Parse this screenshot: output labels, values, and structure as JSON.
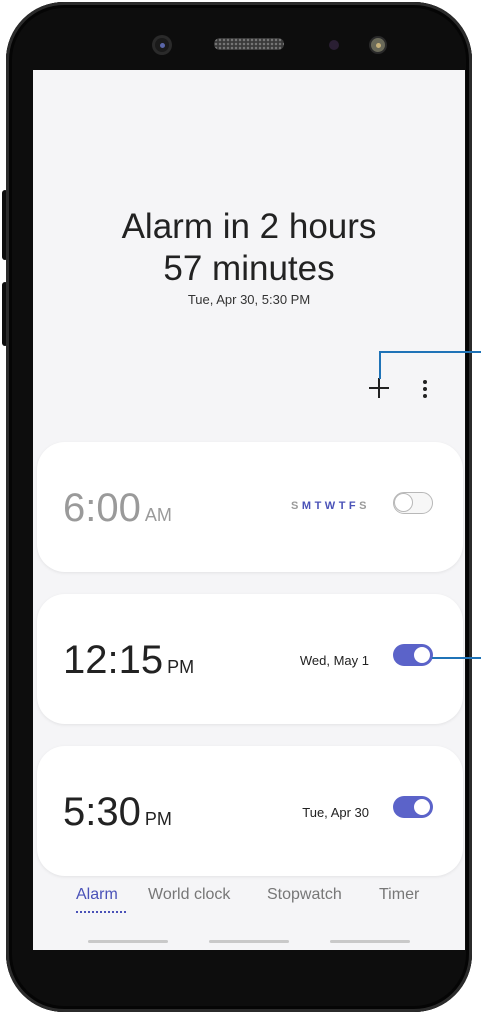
{
  "alarm_summary": {
    "line1": "Alarm in 2 hours",
    "line2": "57 minutes",
    "next_alarm": "Tue, Apr 30, 5:30 PM"
  },
  "toolbar": {
    "add_icon": "plus-icon",
    "more_icon": "more-options-icon"
  },
  "alarms": [
    {
      "time": "6:00",
      "ampm": "AM",
      "days": [
        "S",
        "M",
        "T",
        "W",
        "T",
        "F",
        "S"
      ],
      "enabled": false
    },
    {
      "time": "12:15",
      "ampm": "PM",
      "date": "Wed, May 1",
      "enabled": true
    },
    {
      "time": "5:30",
      "ampm": "PM",
      "date": "Tue, Apr 30",
      "enabled": true
    }
  ],
  "tabs": [
    {
      "label": "Alarm",
      "active": true
    },
    {
      "label": "World clock",
      "active": false
    },
    {
      "label": "Stopwatch",
      "active": false
    },
    {
      "label": "Timer",
      "active": false
    }
  ],
  "colors": {
    "accent": "#5b63c9",
    "callout": "#1f73b7",
    "weekday_active": "#4a52b8",
    "weekend_muted": "#9a9a9a"
  }
}
